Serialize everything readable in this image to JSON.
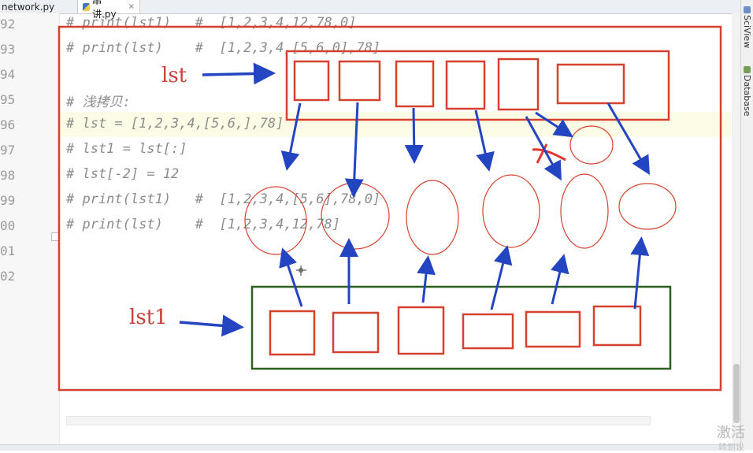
{
  "tabs": [
    {
      "label": "network.py",
      "active": false
    },
    {
      "label": "串讲.py",
      "active": true,
      "close": "×"
    }
  ],
  "gutter": {
    "line_numbers": [
      "92",
      "93",
      "94",
      "95",
      "96",
      "97",
      "98",
      "99",
      "00",
      "01",
      "02"
    ]
  },
  "code_lines": [
    "# print(lst1)   #  [1,2,3,4,12,78,0]",
    "# print(lst)    #  [1,2,3,4,[5,6,0],78]",
    "",
    "# 浅拷贝:",
    "# lst = [1,2,3,4,[5,6,],78]",
    "# lst1 = lst[:]",
    "# lst[-2] = 12",
    "# print(lst1)   #  [1,2,3,4,[5,6],78,0]",
    "# print(lst)    #  [1,2,3,4,12,78]",
    "",
    ""
  ],
  "annotation": {
    "label_lst": "lst",
    "label_lst1": "lst1",
    "colors": {
      "frame": "#d6412f",
      "green_box": "#2e5e24",
      "arrow": "#2445c2",
      "cross": "#e0352b"
    }
  },
  "right_toolbar": {
    "items": [
      {
        "label": "SciView",
        "icon": "sciview-icon"
      },
      {
        "label": "Database",
        "icon": "database-icon"
      }
    ]
  },
  "watermark": {
    "line1": "激活",
    "line2": "转到设"
  }
}
